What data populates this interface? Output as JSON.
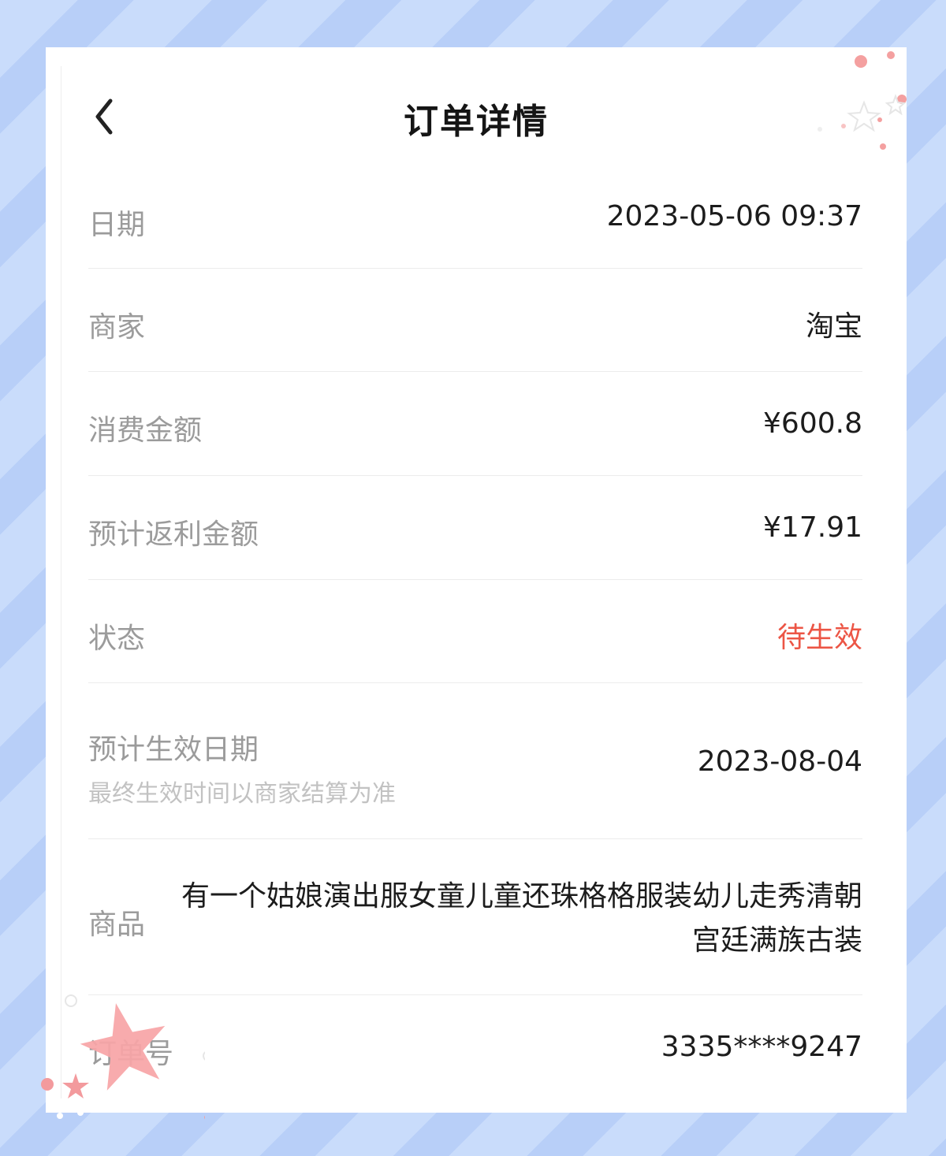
{
  "header": {
    "title": "订单详情",
    "back_icon": "chevron-left-icon"
  },
  "rows": [
    {
      "label": "日期",
      "value": "2023-05-06 09:37"
    },
    {
      "label": "商家",
      "value": "淘宝"
    },
    {
      "label": "消费金额",
      "value": "¥600.8"
    },
    {
      "label": "预计返利金额",
      "value": "¥17.91"
    },
    {
      "label": "状态",
      "value": "待生效"
    },
    {
      "label": "预计生效日期",
      "sublabel": "最终生效时间以商家结算为准",
      "value": "2023-08-04"
    },
    {
      "label": "商品",
      "value": "有一个姑娘演出服女童儿童还珠格格服装幼儿走秀清朝宫廷满族古装"
    },
    {
      "label": "订单号",
      "value": "3335****9247"
    }
  ],
  "colors": {
    "status": "#ec5545",
    "background": "#c9dcfb",
    "label": "#9b9b9b",
    "value": "#1c1c1c"
  }
}
